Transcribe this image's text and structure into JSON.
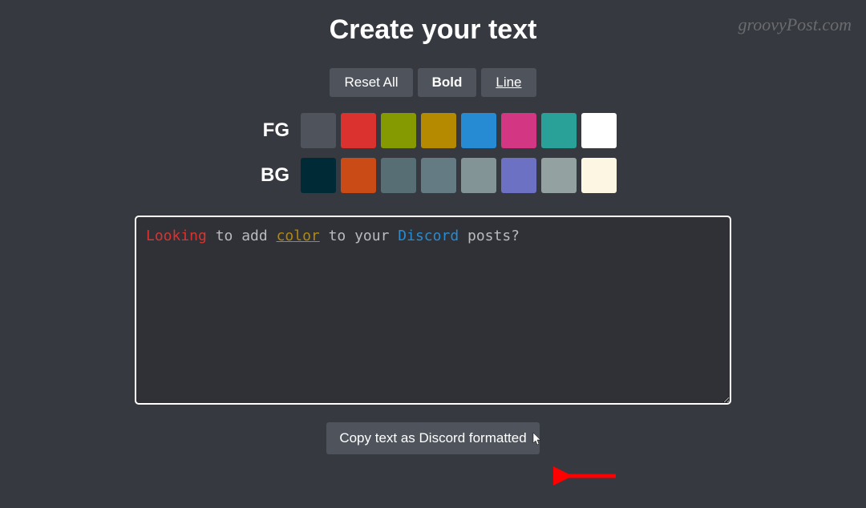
{
  "watermark": "groovyPost.com",
  "title": "Create your text",
  "buttons": {
    "reset": "Reset All",
    "bold": "Bold",
    "line": "Line"
  },
  "fg": {
    "label": "FG",
    "colors": [
      "#4f545c",
      "#dc322f",
      "#859900",
      "#b58900",
      "#268bd2",
      "#d33682",
      "#2aa198",
      "#ffffff"
    ]
  },
  "bg": {
    "label": "BG",
    "colors": [
      "#002b36",
      "#cb4b16",
      "#586e75",
      "#657b83",
      "#839496",
      "#6c71c4",
      "#93a1a1",
      "#fdf6e3"
    ]
  },
  "editor": {
    "tokens": [
      {
        "text": "Looking",
        "cls": "tok-red"
      },
      {
        "text": " to add ",
        "cls": ""
      },
      {
        "text": "color",
        "cls": "tok-yellow"
      },
      {
        "text": " to your ",
        "cls": ""
      },
      {
        "text": "Discord",
        "cls": "tok-blue"
      },
      {
        "text": " posts?",
        "cls": ""
      }
    ]
  },
  "copy_button": "Copy text as Discord formatted"
}
